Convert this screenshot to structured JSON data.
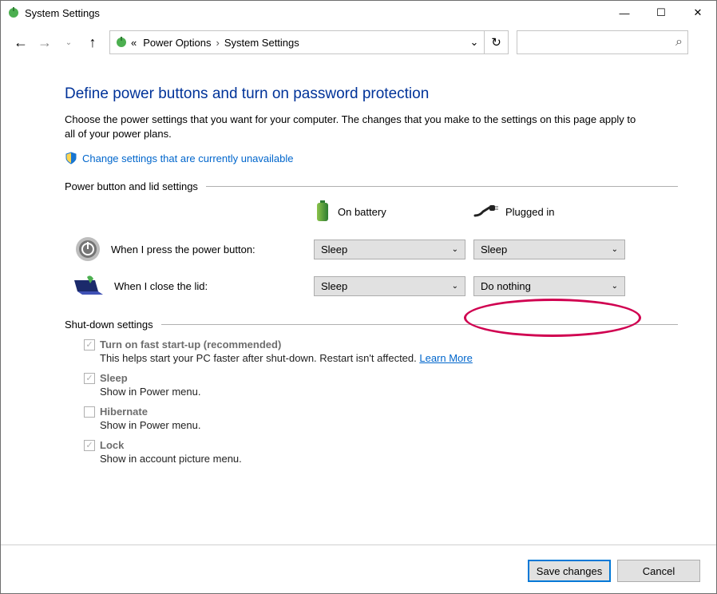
{
  "window": {
    "title": "System Settings",
    "minimize_glyph": "—",
    "maximize_glyph": "☐",
    "close_glyph": "✕"
  },
  "breadcrumb": {
    "back_hint": "Back",
    "forward_hint": "Forward",
    "up_hint": "Up",
    "root_glyph": "«",
    "items": [
      "Power Options",
      "System Settings"
    ],
    "refresh_glyph": "↻"
  },
  "search": {
    "placeholder": "",
    "icon_glyph": "⌕"
  },
  "header": "Define power buttons and turn on password protection",
  "intro": "Choose the power settings that you want for your computer. The changes that you make to the settings on this page apply to all of your power plans.",
  "change_link": "Change settings that are currently unavailable",
  "section1_title": "Power button and lid settings",
  "col_headers": {
    "battery": "On battery",
    "plugged": "Plugged in"
  },
  "rows": {
    "power_button": {
      "label": "When I press the power button:",
      "battery": "Sleep",
      "plugged": "Sleep"
    },
    "close_lid": {
      "label": "When I close the lid:",
      "battery": "Sleep",
      "plugged": "Do nothing"
    }
  },
  "section2_title": "Shut-down settings",
  "shutdown": {
    "fast_startup": {
      "label": "Turn on fast start-up (recommended)",
      "desc": "This helps start your PC faster after shut-down. Restart isn't affected. ",
      "learn": "Learn More",
      "checked": true
    },
    "sleep": {
      "label": "Sleep",
      "desc": "Show in Power menu.",
      "checked": true
    },
    "hibernate": {
      "label": "Hibernate",
      "desc": "Show in Power menu.",
      "checked": false
    },
    "lock": {
      "label": "Lock",
      "desc": "Show in account picture menu.",
      "checked": true
    }
  },
  "buttons": {
    "save": "Save changes",
    "cancel": "Cancel"
  }
}
